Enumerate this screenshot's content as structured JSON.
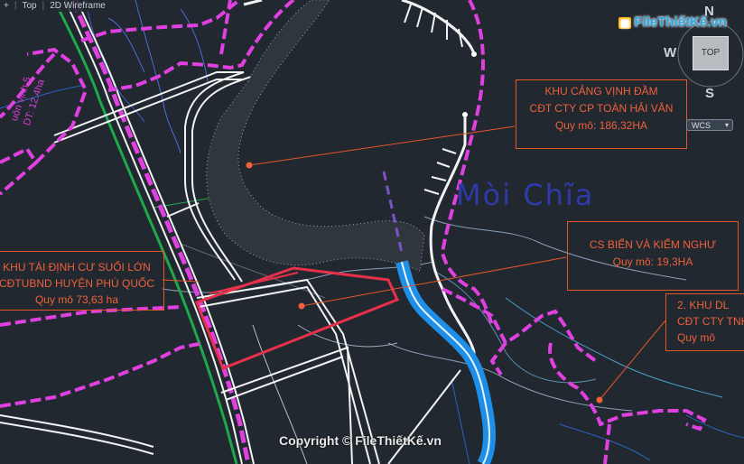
{
  "viewport": {
    "menu_label": "+",
    "view_label": "Top",
    "style_label": "2D Wireframe"
  },
  "watermark": {
    "logo_text": "FileThiếtKế.vn",
    "copyright": "Copyright © FileThiếtKế.vn"
  },
  "navigation": {
    "north": "N",
    "south": "S",
    "west": "W",
    "top_button": "TOP",
    "wcs_label": "WCS",
    "wcs_chevron": "▾"
  },
  "annotations": [
    {
      "line1": "KHU CẢNG VỊNH ĐẦM",
      "line2": "CĐT CTY CP TOÀN HẢI VÂN",
      "line3": "Quy mô: 186,32HA"
    },
    {
      "line1": "CS BIỂN VÀ KIỂM NGHƯ",
      "line2": "Quy mô: 19,3HA",
      "line3": ""
    },
    {
      "line1": "KHU TÁI ĐỊNH CƯ SUỐI LỚN",
      "line2": "CĐTUBND HUYỆN PHÚ QUỐC",
      "line3": "Quy mô 73,63 ha"
    },
    {
      "line1": "2. KHU DL",
      "line2": "CĐT CTY TNH",
      "line3": "Quy mô"
    }
  ],
  "map_labels": {
    "place_name": "Mòi Chĩa",
    "rotated_1": "uôn vịnh 5",
    "rotated_2": "DT: 12.4ha"
  },
  "colors": {
    "background": "#212830",
    "boundary_magenta": "#e040e0",
    "red_boundary": "#e8304a",
    "road_white": "#f2f2f2",
    "green_line": "#1fa84a",
    "water_blue": "#1e8fe8",
    "annotation_orange": "#e5562a"
  }
}
